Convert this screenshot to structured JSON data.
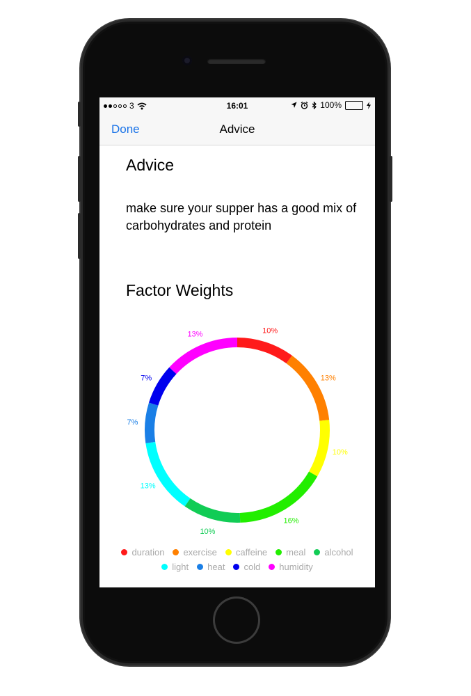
{
  "status_bar": {
    "carrier": "3",
    "time": "16:01",
    "battery": "100%"
  },
  "nav": {
    "done_label": "Done",
    "title": "Advice"
  },
  "content": {
    "advice_heading": "Advice",
    "advice_text": "make sure your supper has a good mix of carbohydrates and protein",
    "weights_heading": "Factor Weights"
  },
  "chart_data": {
    "type": "pie",
    "variant": "donut",
    "start_angle_deg": 0,
    "direction": "clockwise",
    "slices": [
      {
        "name": "duration",
        "value": 10,
        "label": "10%",
        "color": "#ff1a1a"
      },
      {
        "name": "exercise",
        "value": 13,
        "label": "13%",
        "color": "#ff8000"
      },
      {
        "name": "caffeine",
        "value": 10,
        "label": "10%",
        "color": "#ffff00"
      },
      {
        "name": "meal",
        "value": 16,
        "label": "16%",
        "color": "#22ee00"
      },
      {
        "name": "alcohol",
        "value": 10,
        "label": "10%",
        "color": "#11cc55"
      },
      {
        "name": "light",
        "value": 13,
        "label": "13%",
        "color": "#00ffff"
      },
      {
        "name": "heat",
        "value": 7,
        "label": "7%",
        "color": "#1a7fe6"
      },
      {
        "name": "cold",
        "value": 7,
        "label": "7%",
        "color": "#0000ee"
      },
      {
        "name": "humidity",
        "value": 13,
        "label": "13%",
        "color": "#ff00ff"
      }
    ],
    "legend_position": "bottom"
  }
}
